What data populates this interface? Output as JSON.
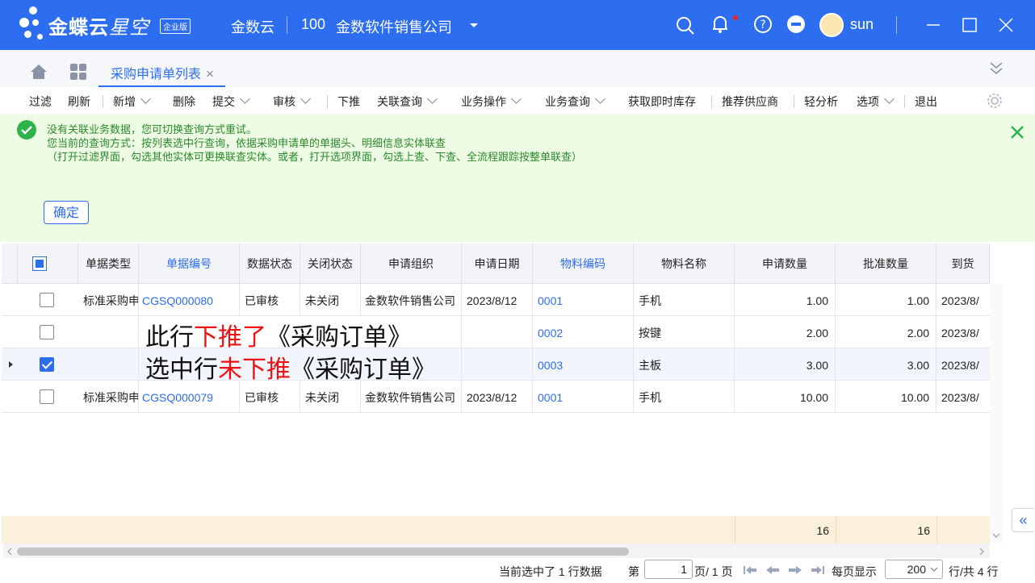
{
  "titlebar": {
    "brand": "金蝶云",
    "brand_sub": "星空",
    "edition": "企业版",
    "cloud_label": "金数云",
    "account_code": "100",
    "company": "金数软件销售公司",
    "username": "sun",
    "accent_color": "#2d6df0"
  },
  "tabs": {
    "active_label": "采购申请单列表"
  },
  "toolbar": {
    "filter": "过滤",
    "refresh": "刷新",
    "new": "新增",
    "delete": "删除",
    "submit": "提交",
    "audit": "审核",
    "push_down": "下推",
    "related_query": "关联查询",
    "business_ops": "业务操作",
    "business_query": "业务查询",
    "get_stock": "获取即时库存",
    "recommend_supplier": "推荐供应商",
    "light_analysis": "轻分析",
    "options": "选项",
    "exit": "退出"
  },
  "notice": {
    "line1": "没有关联业务数据，您可切换查询方式重试。",
    "line2": "您当前的查询方式：按列表选中行查询，依据采购申请单的单据头、明细信息实体联查",
    "line3": "（打开过滤界面，勾选其他实体可更换联查实体。或者，打开选项界面，勾选上查、下查、全流程跟踪按整单联查）",
    "confirm": "确定"
  },
  "grid": {
    "headers": [
      "单据类型",
      "单据编号",
      "数据状态",
      "关闭状态",
      "申请组织",
      "申请日期",
      "物料编码",
      "物料名称",
      "申请数量",
      "批准数量",
      "到货"
    ],
    "rows": [
      {
        "checked": false,
        "type": "标准采购申",
        "code": "CGSQ000080",
        "status": "已审核",
        "close": "未关闭",
        "org": "金数软件销售公司",
        "date": "2023/8/12",
        "material_code": "0001",
        "material_name": "手机",
        "qty": "1.00",
        "approved": "1.00",
        "arrival": "2023/8/"
      },
      {
        "checked": false,
        "type": "",
        "code": "",
        "status": "",
        "close": "",
        "org": "",
        "date": "",
        "material_code": "0002",
        "material_name": "按键",
        "qty": "2.00",
        "approved": "2.00",
        "arrival": "2023/8/"
      },
      {
        "checked": true,
        "type": "",
        "code": "",
        "status": "",
        "close": "",
        "org": "",
        "date": "",
        "material_code": "0003",
        "material_name": "主板",
        "qty": "3.00",
        "approved": "3.00",
        "arrival": "2023/8/"
      },
      {
        "checked": false,
        "type": "标准采购申",
        "code": "CGSQ000079",
        "status": "已审核",
        "close": "未关闭",
        "org": "金数软件销售公司",
        "date": "2023/8/12",
        "material_code": "0001",
        "material_name": "手机",
        "qty": "10.00",
        "approved": "10.00",
        "arrival": "2023/8/"
      }
    ],
    "annotation1": {
      "a": "此行",
      "b": "下推了",
      "c": "《采购订单》"
    },
    "annotation2": {
      "a": "选中行",
      "b": "未下推",
      "c": "《采购订单》"
    },
    "totals": {
      "qty": "16",
      "approved": "16"
    }
  },
  "status": {
    "selected_prefix": "当前选中了",
    "selected_count": "1",
    "selected_suffix": "行数据",
    "page_label": "第",
    "page_value": "1",
    "page_of": "页/ 1 页",
    "per_page_label": "每页显示",
    "per_page_value": "200",
    "total_label": "行/共 4 行"
  }
}
